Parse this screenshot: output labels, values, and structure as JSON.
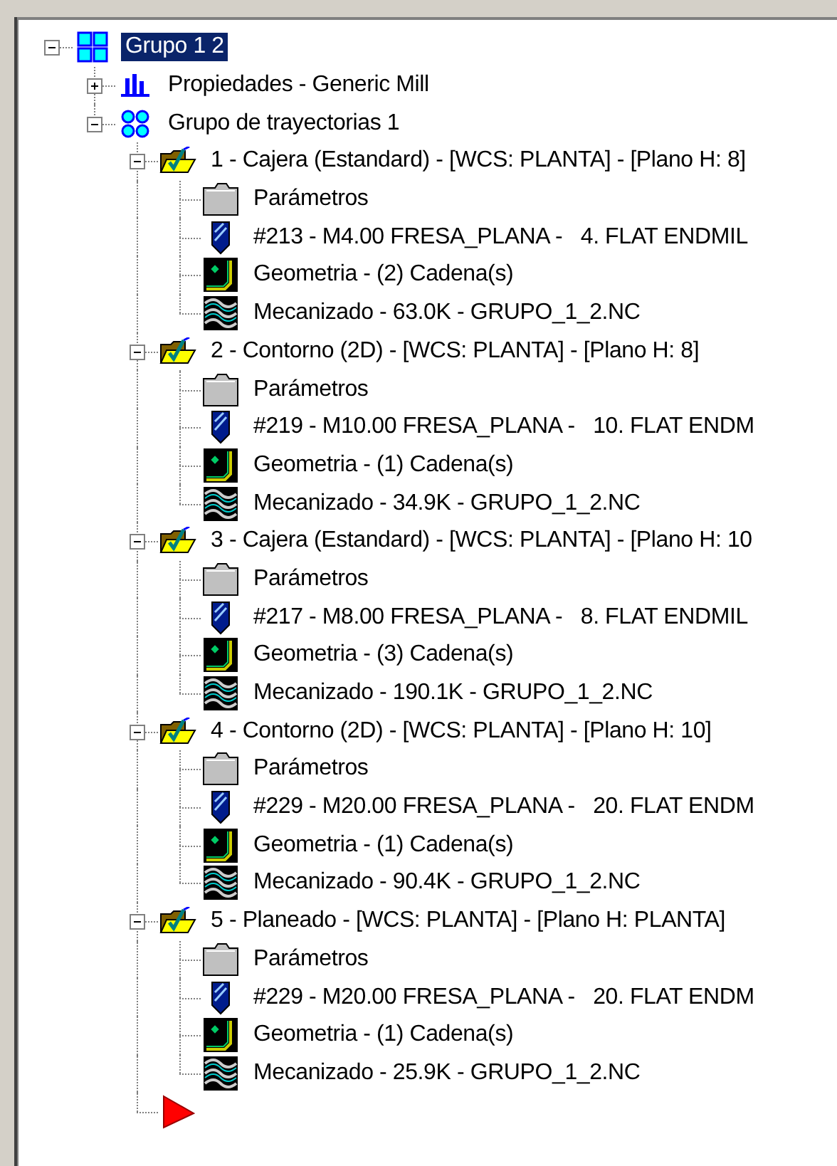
{
  "tree": [
    {
      "kind": "group",
      "label": "Grupo 1 2",
      "selected": true,
      "expanded": true,
      "children": [
        {
          "kind": "properties",
          "label": "Propiedades - Generic Mill",
          "selected": false,
          "expanded": false
        },
        {
          "kind": "toolpath-group",
          "label": "Grupo de trayectorias 1",
          "selected": false,
          "expanded": true,
          "children": [
            {
              "kind": "operation",
              "label": "1 - Cajera (Estandard) - [WCS: PLANTA] - [Plano H: 8]",
              "selected": false,
              "expanded": true,
              "children": [
                {
                  "kind": "parameters",
                  "label": "Parámetros",
                  "selected": false
                },
                {
                  "kind": "tool",
                  "label": "#213 - M4.00 FRESA_PLANA -   4. FLAT ENDMIL",
                  "selected": false
                },
                {
                  "kind": "geometry",
                  "label": "Geometria - (2) Cadena(s)",
                  "selected": false
                },
                {
                  "kind": "toolpath",
                  "label": "Mecanizado - 63.0K - GRUPO_1_2.NC",
                  "selected": false
                }
              ]
            },
            {
              "kind": "operation",
              "label": "2 - Contorno (2D) - [WCS: PLANTA] - [Plano H: 8]",
              "selected": false,
              "expanded": true,
              "children": [
                {
                  "kind": "parameters",
                  "label": "Parámetros",
                  "selected": false
                },
                {
                  "kind": "tool",
                  "label": "#219 - M10.00 FRESA_PLANA -   10. FLAT ENDM",
                  "selected": false
                },
                {
                  "kind": "geometry",
                  "label": "Geometria - (1) Cadena(s)",
                  "selected": false
                },
                {
                  "kind": "toolpath",
                  "label": "Mecanizado - 34.9K - GRUPO_1_2.NC",
                  "selected": false
                }
              ]
            },
            {
              "kind": "operation",
              "label": "3 - Cajera (Estandard) - [WCS: PLANTA] - [Plano H: 10",
              "selected": false,
              "expanded": true,
              "children": [
                {
                  "kind": "parameters",
                  "label": "Parámetros",
                  "selected": false
                },
                {
                  "kind": "tool",
                  "label": "#217 - M8.00 FRESA_PLANA -   8. FLAT ENDMIL",
                  "selected": false
                },
                {
                  "kind": "geometry",
                  "label": "Geometria - (3) Cadena(s)",
                  "selected": false
                },
                {
                  "kind": "toolpath",
                  "label": "Mecanizado - 190.1K - GRUPO_1_2.NC",
                  "selected": false
                }
              ]
            },
            {
              "kind": "operation",
              "label": "4 - Contorno (2D) - [WCS: PLANTA] - [Plano H: 10]",
              "selected": false,
              "expanded": true,
              "children": [
                {
                  "kind": "parameters",
                  "label": "Parámetros",
                  "selected": false
                },
                {
                  "kind": "tool",
                  "label": "#229 - M20.00 FRESA_PLANA -   20. FLAT ENDM",
                  "selected": false
                },
                {
                  "kind": "geometry",
                  "label": "Geometria - (1) Cadena(s)",
                  "selected": false
                },
                {
                  "kind": "toolpath",
                  "label": "Mecanizado - 90.4K - GRUPO_1_2.NC",
                  "selected": false
                }
              ]
            },
            {
              "kind": "operation",
              "label": "5 - Planeado - [WCS: PLANTA] - [Plano H: PLANTA]",
              "selected": false,
              "expanded": true,
              "children": [
                {
                  "kind": "parameters",
                  "label": "Parámetros",
                  "selected": false
                },
                {
                  "kind": "tool",
                  "label": "#229 - M20.00 FRESA_PLANA -   20. FLAT ENDM",
                  "selected": false
                },
                {
                  "kind": "geometry",
                  "label": "Geometria - (1) Cadena(s)",
                  "selected": false
                },
                {
                  "kind": "toolpath",
                  "label": "Mecanizado - 25.9K - GRUPO_1_2.NC",
                  "selected": false
                }
              ]
            },
            {
              "kind": "insert-marker"
            }
          ]
        }
      ]
    }
  ]
}
